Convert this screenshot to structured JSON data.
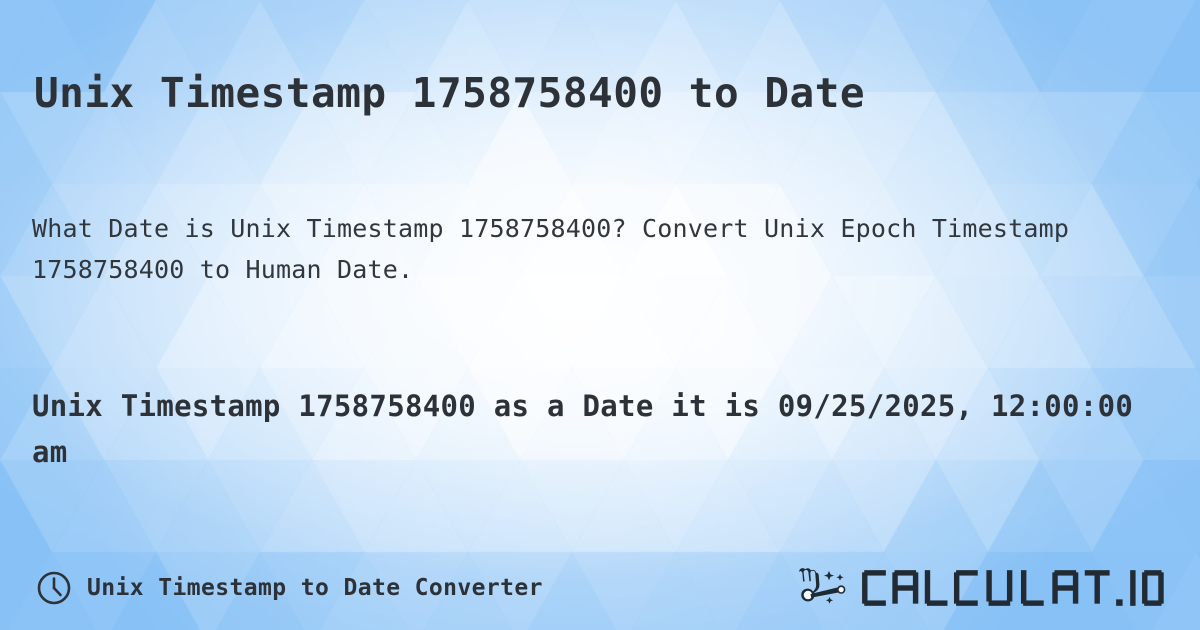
{
  "meta": {
    "timestamp": "1758758400",
    "text_color": "#2d3238",
    "bg_accent": "#8ec5f5",
    "bg_light": "#f2f8ff"
  },
  "page_title": "Unix Timestamp 1758758400 to Date",
  "description": "What Date is Unix Timestamp 1758758400? Convert Unix Epoch Timestamp 1758758400 to Human Date.",
  "result": "Unix Timestamp 1758758400 as a Date it is 09/25/2025, 12:00:00 am",
  "result_date": "09/25/2025, 12:00:00 am",
  "footer": {
    "icon": "clock-icon",
    "label": "Unix Timestamp to Date Converter",
    "brand": {
      "icon": "magic-wand-hand-icon",
      "name": "CALCULAT.IO"
    }
  }
}
